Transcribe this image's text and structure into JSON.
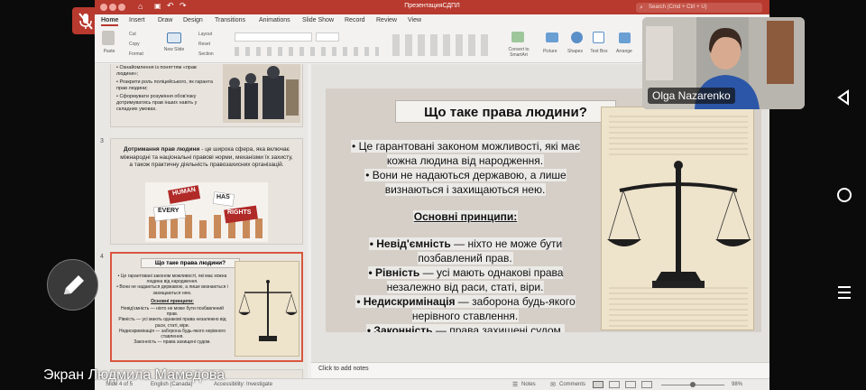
{
  "titlebar": {
    "title": "ПрезентацияСДПЛ",
    "search": "Search (Cmd + Ctrl + U)"
  },
  "ribbon_tabs": [
    "Home",
    "Insert",
    "Draw",
    "Design",
    "Transitions",
    "Animations",
    "Slide Show",
    "Record",
    "Review",
    "View"
  ],
  "ribbon": {
    "paste": "Paste",
    "cut": "Cut",
    "copy": "Copy",
    "format": "Format",
    "new_slide": "New Slide",
    "layout": "Layout",
    "reset": "Reset",
    "section": "Section",
    "convert": "Convert to SmartArt",
    "picture": "Picture",
    "shapes": "Shapes",
    "text_box": "Text Box",
    "arrange": "Arrange"
  },
  "thumb2": {
    "bullets": [
      "• Ознайомлення із поняттям «прав людини»;",
      "• Розкрити роль поліцейського, як гаранта прав людини;",
      "• Сформувати розуміння обов'язку дотримуватись прав інших навіть у складних умовах."
    ]
  },
  "thumb3": {
    "num": "3",
    "text_bold": "Дотримання прав людини",
    "text_rest": " - це широка сфера, яка включає міжнародні та національні правові норми, механізми їх захисту, а також практичну діяльність правозахисних організацій.",
    "sign1": "HUMAN",
    "sign2": "HAS",
    "sign3": "EVERY",
    "sign4": "RIGHTS"
  },
  "thumb4": {
    "num": "4",
    "title": "Що таке права людини?",
    "bullets": [
      "• Це гарантовані законом можливості, які має кожна людина від народження.",
      "• Вони не надаються державою, а лише визнаються і захищаються нею."
    ],
    "heading": "Основні принципи:",
    "principles": [
      "Невід'ємність — ніхто не може бути позбавлений прав.",
      "Рівність — усі мають однакові права незалежно від раси, статі, віри.",
      "Недискримінація — заборона будь-якого нерівного ставлення.",
      "Законність — права захищені судом."
    ]
  },
  "slide": {
    "title": "Що таке права людини?",
    "bullet1": "• Це гарантовані законом можливості, які має кожна людина від народження.",
    "bullet2": "• Вони не надаються державою, а лише визнаються і захищаються нею.",
    "heading": "Основні принципи:",
    "p1_bold": "• Невід'ємність",
    "p1_rest": " — ніхто не може бути позбавлений прав.",
    "p2_bold": "• Рівність",
    "p2_rest": " — усі мають однакові права незалежно від раси, статі, віри.",
    "p3_bold": "• Недискримінація",
    "p3_rest": " — заборона будь-якого нерівного ставлення.",
    "p4_bold": "• Законність",
    "p4_rest": " — права захищені судом."
  },
  "notes_placeholder": "Click to add notes",
  "status": {
    "slide_info": "Slide 4 of 5",
    "language": "English (Canada)",
    "accessibility": "Accessibility: Investigate",
    "notes": "Notes",
    "comments": "Comments",
    "zoom": "98%"
  },
  "video": {
    "name": "Olga Nazarenko"
  },
  "caption": "Экран Людмила Мамедова",
  "icons": {
    "mic": "mic-off-icon",
    "pencil": "pencil-icon",
    "back": "back-icon",
    "home": "home-icon",
    "menu": "menu-icon"
  }
}
